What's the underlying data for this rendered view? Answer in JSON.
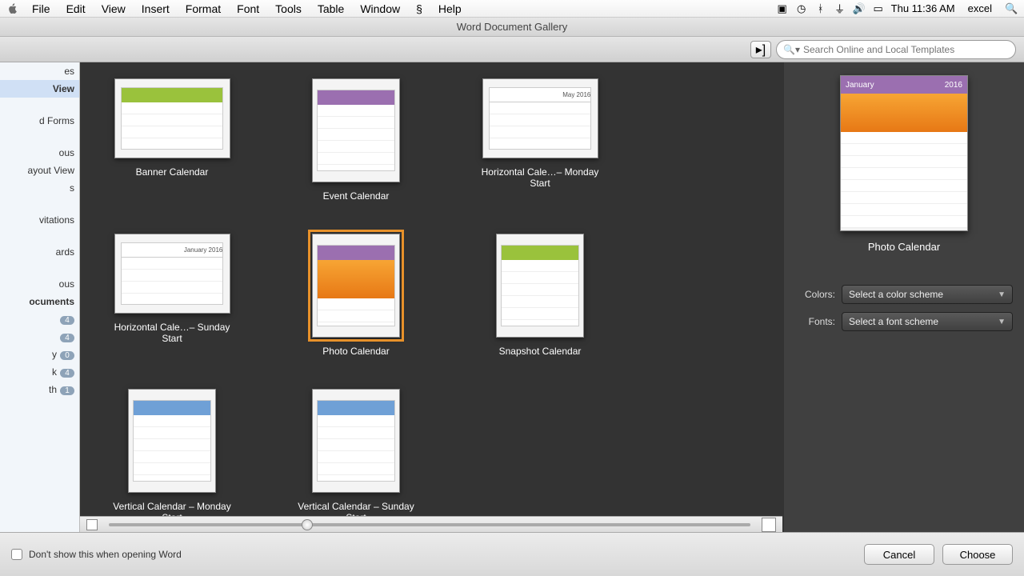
{
  "menubar": {
    "items": [
      "File",
      "Edit",
      "View",
      "Insert",
      "Format",
      "Font",
      "Tools",
      "Table",
      "Window"
    ],
    "help": "Help",
    "clock": "Thu 11:36 AM",
    "appname": "excel"
  },
  "window": {
    "title": "Word Document Gallery"
  },
  "search": {
    "placeholder": "Search Online and Local Templates"
  },
  "sidebar": {
    "items": [
      {
        "label": "es"
      },
      {
        "label": "View",
        "selected": true
      },
      {
        "label": ""
      },
      {
        "label": "d Forms"
      },
      {
        "label": ""
      },
      {
        "label": "ous"
      },
      {
        "label": "ayout View"
      },
      {
        "label": "s"
      },
      {
        "label": ""
      },
      {
        "label": "vitations"
      },
      {
        "label": ""
      },
      {
        "label": "ards"
      },
      {
        "label": ""
      },
      {
        "label": "ous"
      },
      {
        "label": "ocuments",
        "bold": true
      }
    ],
    "badges": [
      "4",
      "4",
      "0",
      "4",
      "1"
    ],
    "recent_labels": [
      "y",
      "k",
      "th"
    ]
  },
  "templates": [
    {
      "label": "Banner Calendar",
      "shape": "wide",
      "head": "green"
    },
    {
      "label": "Event Calendar",
      "shape": "tall",
      "head": "purple"
    },
    {
      "label": "Horizontal Cale…– Monday Start",
      "shape": "wide",
      "head": "blue",
      "sub": "May 2016"
    },
    {
      "label": "Horizontal Cale…– Sunday Start",
      "shape": "wide",
      "head": "blue",
      "sub": "January 2016"
    },
    {
      "label": "Photo Calendar",
      "shape": "tall",
      "head": "purple",
      "photo": true,
      "selected": true
    },
    {
      "label": "Snapshot Calendar",
      "shape": "tall",
      "head": "green"
    },
    {
      "label": "Vertical Calendar – Monday Start",
      "shape": "tall",
      "head": "blue"
    },
    {
      "label": "Vertical Calendar – Sunday Start",
      "shape": "tall",
      "head": "blue"
    }
  ],
  "preview": {
    "title": "Photo Calendar",
    "month_label": "January",
    "year_label": "2016",
    "colors_label": "Colors:",
    "colors_value": "Select a color scheme",
    "fonts_label": "Fonts:",
    "fonts_value": "Select a font scheme"
  },
  "footer": {
    "dont_show": "Don't show this when opening Word",
    "cancel": "Cancel",
    "choose": "Choose"
  }
}
